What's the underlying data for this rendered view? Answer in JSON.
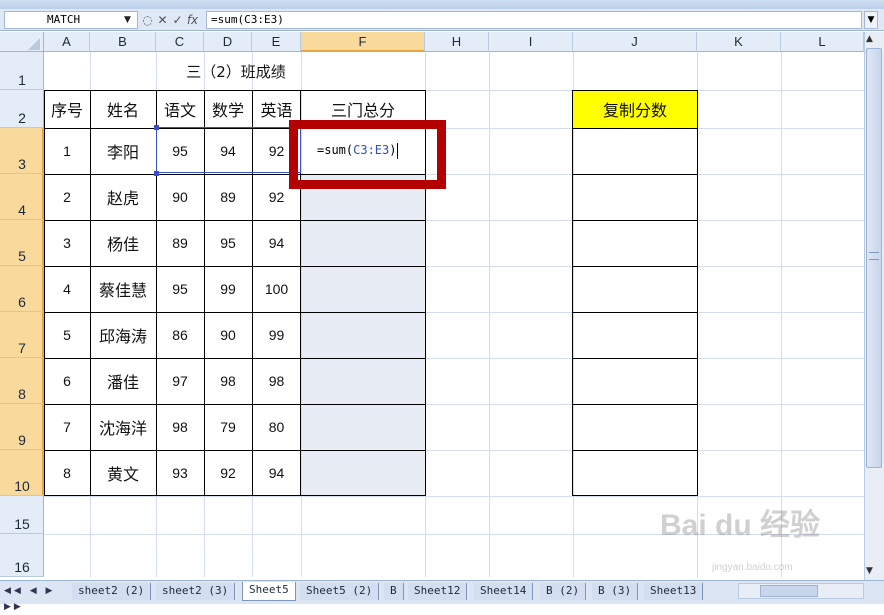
{
  "formula_bar": {
    "name_box": "MATCH",
    "buttons": [
      "✕",
      "✓",
      "fx"
    ],
    "formula": "=sum(C3:E3)"
  },
  "columns": [
    "A",
    "B",
    "C",
    "D",
    "E",
    "F",
    "H",
    "I",
    "J",
    "K",
    "L"
  ],
  "rows": [
    "1",
    "2",
    "3",
    "4",
    "5",
    "6",
    "7",
    "8",
    "9",
    "10",
    "15",
    "16"
  ],
  "sheet": {
    "title": "三（2）班成绩",
    "headers": [
      "序号",
      "姓名",
      "语文",
      "数学",
      "英语",
      "三门总分"
    ],
    "copy_header": "复制分数",
    "records": [
      [
        "1",
        "李阳",
        "95",
        "94",
        "92"
      ],
      [
        "2",
        "赵虎",
        "90",
        "89",
        "92"
      ],
      [
        "3",
        "杨佳",
        "89",
        "95",
        "94"
      ],
      [
        "4",
        "蔡佳慧",
        "95",
        "99",
        "100"
      ],
      [
        "5",
        "邱海涛",
        "86",
        "90",
        "99"
      ],
      [
        "6",
        "潘佳",
        "97",
        "98",
        "98"
      ],
      [
        "7",
        "沈海洋",
        "98",
        "79",
        "80"
      ],
      [
        "8",
        "黄文",
        "93",
        "92",
        "94"
      ]
    ],
    "edit_cell": {
      "prefix": "=sum(",
      "ref": "C3:E3",
      "suffix": ")"
    }
  },
  "tabs": [
    "sheet2 (2)",
    "sheet2 (3)",
    "Sheet5",
    "Sheet5 (2)",
    "B",
    "Sheet12",
    "Sheet14",
    "B (2)",
    "B (3)",
    "Sheet13"
  ],
  "active_tab": "Sheet5",
  "tab_nav": "◀◀ ◀ ▶ ▶▶",
  "watermark": {
    "text": "Bai du 经验",
    "sub": "jingyan.baidu.com"
  },
  "colors": {
    "highlight": "#ffff00",
    "red_box": "#b30000",
    "selection": "#3a50c8"
  }
}
